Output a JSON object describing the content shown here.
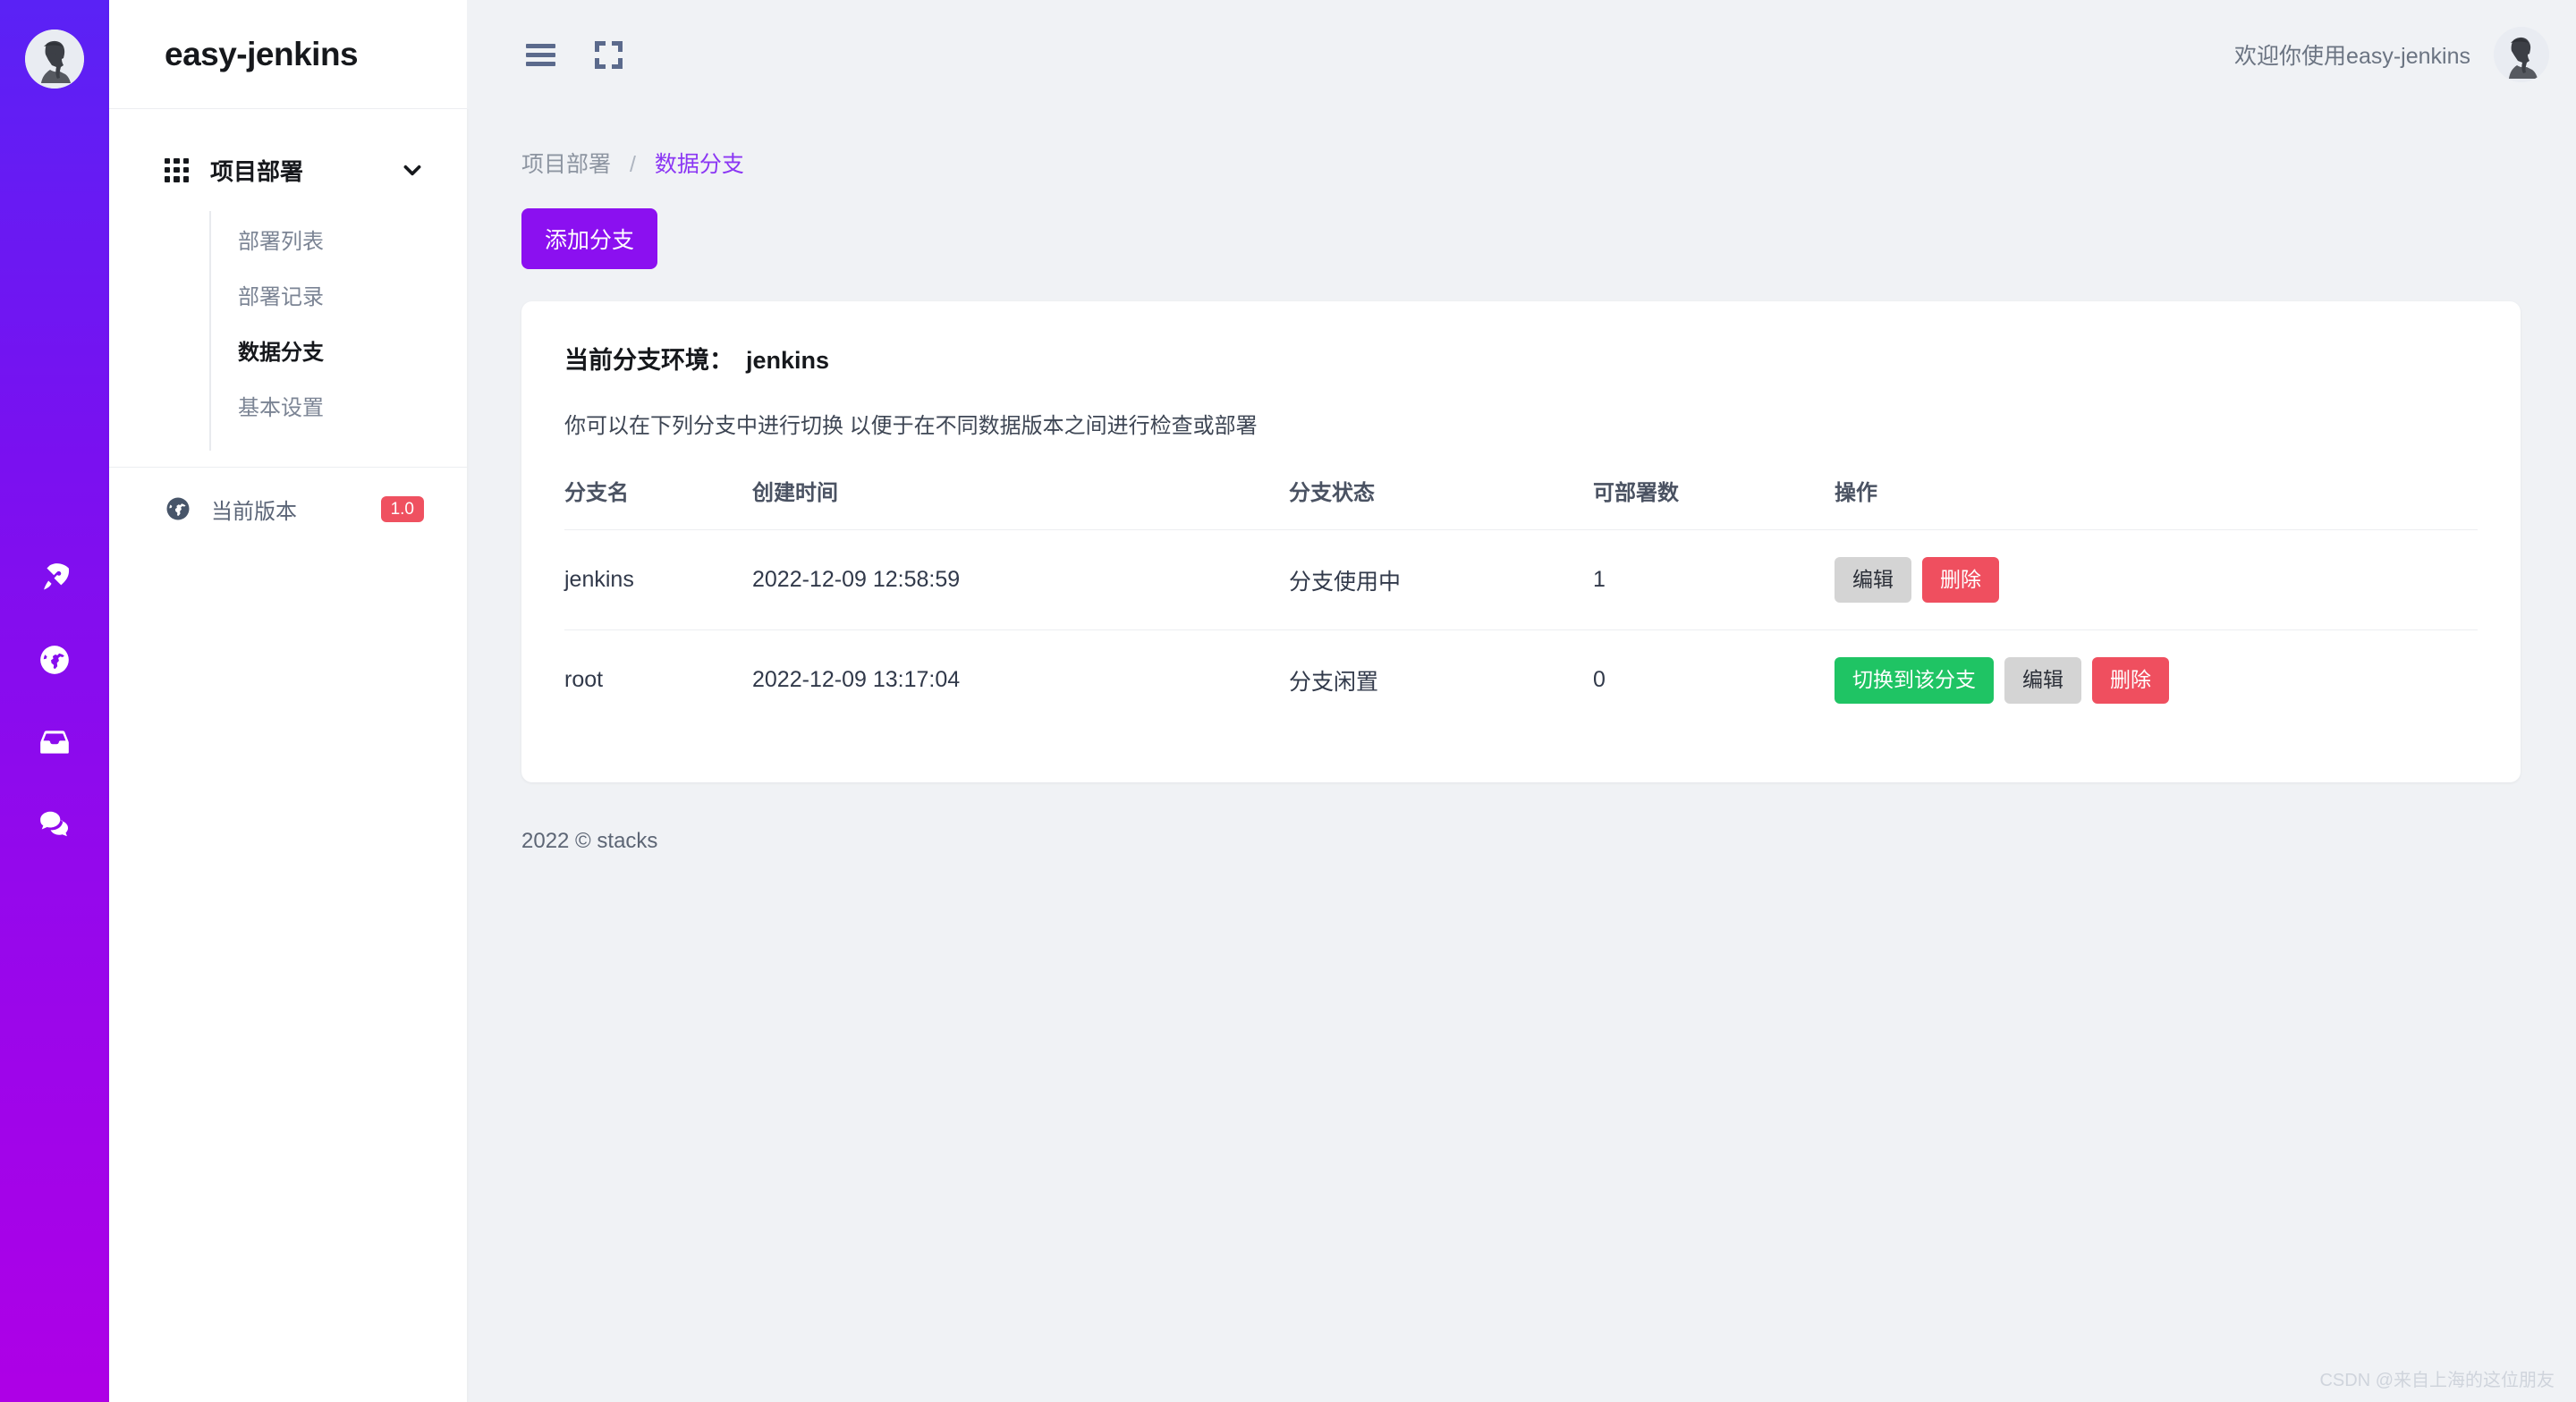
{
  "brand": {
    "title": "easy-jenkins"
  },
  "rail": {
    "avatar_name": "user-avatar",
    "icons": [
      {
        "name": "rocket-icon"
      },
      {
        "name": "globe-icon"
      },
      {
        "name": "inbox-icon"
      },
      {
        "name": "chat-icon"
      }
    ]
  },
  "sidebar": {
    "group": {
      "label": "项目部署",
      "expanded": true,
      "items": [
        {
          "label": "部署列表",
          "active": false
        },
        {
          "label": "部署记录",
          "active": false
        },
        {
          "label": "数据分支",
          "active": true
        },
        {
          "label": "基本设置",
          "active": false
        }
      ]
    },
    "version": {
      "label": "当前版本",
      "badge": "1.0",
      "badge_color": "#ef5160"
    }
  },
  "topbar": {
    "menu_toggle": "menu-icon",
    "fullscreen": "fullscreen-icon",
    "welcome": "欢迎你使用easy-jenkins"
  },
  "breadcrumb": {
    "parent": "项目部署",
    "separator": "/",
    "current": "数据分支"
  },
  "toolbar": {
    "add_label": "添加分支",
    "add_color": "#8b10f0"
  },
  "card": {
    "title_prefix": "当前分支环境：",
    "current_env": "jenkins",
    "description": "你可以在下列分支中进行切换 以便于在不同数据版本之间进行检查或部署",
    "columns": [
      "分支名",
      "创建时间",
      "分支状态",
      "可部署数",
      "操作"
    ],
    "rows": [
      {
        "name": "jenkins",
        "created": "2022-12-09 12:58:59",
        "state": "分支使用中",
        "deployable": "1",
        "actions": [
          {
            "label": "编辑",
            "style": "edit"
          },
          {
            "label": "删除",
            "style": "delete"
          }
        ]
      },
      {
        "name": "root",
        "created": "2022-12-09 13:17:04",
        "state": "分支闲置",
        "deployable": "0",
        "actions": [
          {
            "label": "切换到该分支",
            "style": "switch"
          },
          {
            "label": "编辑",
            "style": "edit"
          },
          {
            "label": "删除",
            "style": "delete"
          }
        ]
      }
    ]
  },
  "footer": {
    "text": "2022 © stacks"
  },
  "watermark": {
    "text": "CSDN @来自上海的这位朋友"
  },
  "colors": {
    "rail_top": "#5a22f5",
    "rail_bottom": "#ae00e6",
    "accent": "#8b10f0",
    "success": "#1fc464",
    "danger": "#ef4f5f",
    "neutral": "#d4d4d4",
    "page_bg": "#f0f2f5"
  }
}
